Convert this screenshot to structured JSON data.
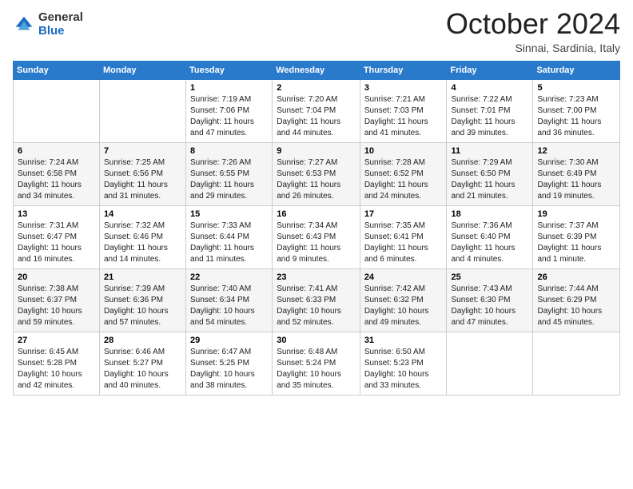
{
  "header": {
    "logo": {
      "general": "General",
      "blue": "Blue"
    },
    "month": "October 2024",
    "location": "Sinnai, Sardinia, Italy"
  },
  "days_of_week": [
    "Sunday",
    "Monday",
    "Tuesday",
    "Wednesday",
    "Thursday",
    "Friday",
    "Saturday"
  ],
  "weeks": [
    [
      {
        "day": "",
        "sunrise": "",
        "sunset": "",
        "daylight": ""
      },
      {
        "day": "",
        "sunrise": "",
        "sunset": "",
        "daylight": ""
      },
      {
        "day": "1",
        "sunrise": "Sunrise: 7:19 AM",
        "sunset": "Sunset: 7:06 PM",
        "daylight": "Daylight: 11 hours and 47 minutes."
      },
      {
        "day": "2",
        "sunrise": "Sunrise: 7:20 AM",
        "sunset": "Sunset: 7:04 PM",
        "daylight": "Daylight: 11 hours and 44 minutes."
      },
      {
        "day": "3",
        "sunrise": "Sunrise: 7:21 AM",
        "sunset": "Sunset: 7:03 PM",
        "daylight": "Daylight: 11 hours and 41 minutes."
      },
      {
        "day": "4",
        "sunrise": "Sunrise: 7:22 AM",
        "sunset": "Sunset: 7:01 PM",
        "daylight": "Daylight: 11 hours and 39 minutes."
      },
      {
        "day": "5",
        "sunrise": "Sunrise: 7:23 AM",
        "sunset": "Sunset: 7:00 PM",
        "daylight": "Daylight: 11 hours and 36 minutes."
      }
    ],
    [
      {
        "day": "6",
        "sunrise": "Sunrise: 7:24 AM",
        "sunset": "Sunset: 6:58 PM",
        "daylight": "Daylight: 11 hours and 34 minutes."
      },
      {
        "day": "7",
        "sunrise": "Sunrise: 7:25 AM",
        "sunset": "Sunset: 6:56 PM",
        "daylight": "Daylight: 11 hours and 31 minutes."
      },
      {
        "day": "8",
        "sunrise": "Sunrise: 7:26 AM",
        "sunset": "Sunset: 6:55 PM",
        "daylight": "Daylight: 11 hours and 29 minutes."
      },
      {
        "day": "9",
        "sunrise": "Sunrise: 7:27 AM",
        "sunset": "Sunset: 6:53 PM",
        "daylight": "Daylight: 11 hours and 26 minutes."
      },
      {
        "day": "10",
        "sunrise": "Sunrise: 7:28 AM",
        "sunset": "Sunset: 6:52 PM",
        "daylight": "Daylight: 11 hours and 24 minutes."
      },
      {
        "day": "11",
        "sunrise": "Sunrise: 7:29 AM",
        "sunset": "Sunset: 6:50 PM",
        "daylight": "Daylight: 11 hours and 21 minutes."
      },
      {
        "day": "12",
        "sunrise": "Sunrise: 7:30 AM",
        "sunset": "Sunset: 6:49 PM",
        "daylight": "Daylight: 11 hours and 19 minutes."
      }
    ],
    [
      {
        "day": "13",
        "sunrise": "Sunrise: 7:31 AM",
        "sunset": "Sunset: 6:47 PM",
        "daylight": "Daylight: 11 hours and 16 minutes."
      },
      {
        "day": "14",
        "sunrise": "Sunrise: 7:32 AM",
        "sunset": "Sunset: 6:46 PM",
        "daylight": "Daylight: 11 hours and 14 minutes."
      },
      {
        "day": "15",
        "sunrise": "Sunrise: 7:33 AM",
        "sunset": "Sunset: 6:44 PM",
        "daylight": "Daylight: 11 hours and 11 minutes."
      },
      {
        "day": "16",
        "sunrise": "Sunrise: 7:34 AM",
        "sunset": "Sunset: 6:43 PM",
        "daylight": "Daylight: 11 hours and 9 minutes."
      },
      {
        "day": "17",
        "sunrise": "Sunrise: 7:35 AM",
        "sunset": "Sunset: 6:41 PM",
        "daylight": "Daylight: 11 hours and 6 minutes."
      },
      {
        "day": "18",
        "sunrise": "Sunrise: 7:36 AM",
        "sunset": "Sunset: 6:40 PM",
        "daylight": "Daylight: 11 hours and 4 minutes."
      },
      {
        "day": "19",
        "sunrise": "Sunrise: 7:37 AM",
        "sunset": "Sunset: 6:39 PM",
        "daylight": "Daylight: 11 hours and 1 minute."
      }
    ],
    [
      {
        "day": "20",
        "sunrise": "Sunrise: 7:38 AM",
        "sunset": "Sunset: 6:37 PM",
        "daylight": "Daylight: 10 hours and 59 minutes."
      },
      {
        "day": "21",
        "sunrise": "Sunrise: 7:39 AM",
        "sunset": "Sunset: 6:36 PM",
        "daylight": "Daylight: 10 hours and 57 minutes."
      },
      {
        "day": "22",
        "sunrise": "Sunrise: 7:40 AM",
        "sunset": "Sunset: 6:34 PM",
        "daylight": "Daylight: 10 hours and 54 minutes."
      },
      {
        "day": "23",
        "sunrise": "Sunrise: 7:41 AM",
        "sunset": "Sunset: 6:33 PM",
        "daylight": "Daylight: 10 hours and 52 minutes."
      },
      {
        "day": "24",
        "sunrise": "Sunrise: 7:42 AM",
        "sunset": "Sunset: 6:32 PM",
        "daylight": "Daylight: 10 hours and 49 minutes."
      },
      {
        "day": "25",
        "sunrise": "Sunrise: 7:43 AM",
        "sunset": "Sunset: 6:30 PM",
        "daylight": "Daylight: 10 hours and 47 minutes."
      },
      {
        "day": "26",
        "sunrise": "Sunrise: 7:44 AM",
        "sunset": "Sunset: 6:29 PM",
        "daylight": "Daylight: 10 hours and 45 minutes."
      }
    ],
    [
      {
        "day": "27",
        "sunrise": "Sunrise: 6:45 AM",
        "sunset": "Sunset: 5:28 PM",
        "daylight": "Daylight: 10 hours and 42 minutes."
      },
      {
        "day": "28",
        "sunrise": "Sunrise: 6:46 AM",
        "sunset": "Sunset: 5:27 PM",
        "daylight": "Daylight: 10 hours and 40 minutes."
      },
      {
        "day": "29",
        "sunrise": "Sunrise: 6:47 AM",
        "sunset": "Sunset: 5:25 PM",
        "daylight": "Daylight: 10 hours and 38 minutes."
      },
      {
        "day": "30",
        "sunrise": "Sunrise: 6:48 AM",
        "sunset": "Sunset: 5:24 PM",
        "daylight": "Daylight: 10 hours and 35 minutes."
      },
      {
        "day": "31",
        "sunrise": "Sunrise: 6:50 AM",
        "sunset": "Sunset: 5:23 PM",
        "daylight": "Daylight: 10 hours and 33 minutes."
      },
      {
        "day": "",
        "sunrise": "",
        "sunset": "",
        "daylight": ""
      },
      {
        "day": "",
        "sunrise": "",
        "sunset": "",
        "daylight": ""
      }
    ]
  ]
}
